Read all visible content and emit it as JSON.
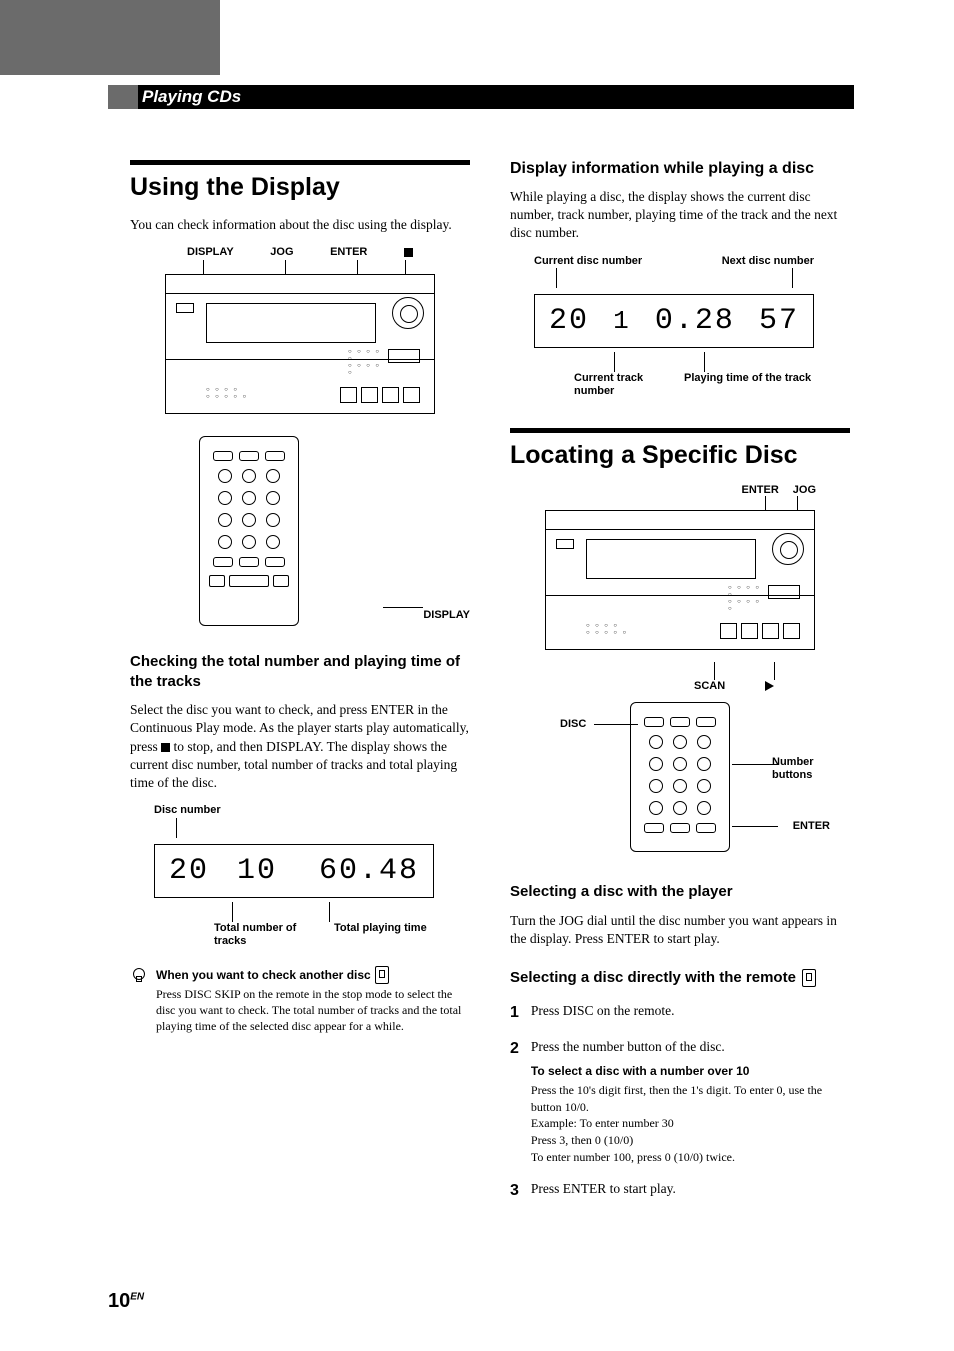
{
  "section_bar": "Playing CDs",
  "left": {
    "h1": "Using the Display",
    "intro": "You can check information about the disc using the display.",
    "device_labels": {
      "display": "DISPLAY",
      "jog": "JOG",
      "enter": "ENTER"
    },
    "remote_label": "DISPLAY",
    "h3_check": "Checking the total number and playing time of the tracks",
    "check_body": "Select the disc you want to check, and press ENTER in the Continuous Play mode. As the player starts play automatically, press ■ to stop, and then DISPLAY. The display shows the current disc number, total number of tracks and total playing time of the disc.",
    "lcd1_labels": {
      "disc_number": "Disc number",
      "total_tracks": "Total number of tracks",
      "total_time": "Total playing time"
    },
    "lcd1_values": {
      "disc": "20",
      "tracks": "10",
      "time": "60.48"
    },
    "tip_title": "When you want to check another disc",
    "tip_body": "Press DISC SKIP on the remote in the stop mode to select the disc you want to check. The total number of tracks and the total playing time of the selected disc appear for a while."
  },
  "right": {
    "h2_info": "Display information while playing a disc",
    "info_body": "While playing a disc, the display shows the current disc number, track number, playing time of the track and the next disc number.",
    "lcd2_labels": {
      "cur_disc": "Current disc number",
      "next_disc": "Next disc number",
      "cur_track": "Current track number",
      "play_time": "Playing time of the track"
    },
    "lcd2_values": {
      "cur_disc": "20",
      "track": "1",
      "time": "0.28",
      "next_disc": "57"
    },
    "h1_locate": "Locating a Specific Disc",
    "device2_labels": {
      "enter": "ENTER",
      "jog": "JOG",
      "scan": "SCAN"
    },
    "remote2_labels": {
      "disc": "DISC",
      "number": "Number buttons",
      "enter": "ENTER"
    },
    "h3_sel_player": "Selecting a disc with the player",
    "sel_player_body": "Turn the JOG dial until the disc number you want appears in the display. Press ENTER to start play.",
    "h3_sel_remote": "Selecting a disc directly with the remote",
    "steps": {
      "s1": "Press DISC on the remote.",
      "s2": "Press the number button of the disc.",
      "s2_note_title": "To select a disc with a number over 10",
      "s2_note_body1": "Press the 10's digit first, then the 1's digit. To enter 0, use the button 10/0.",
      "s2_note_body2": "Example:   To enter number 30",
      "s2_note_body3": "                  Press 3, then 0 (10/0)",
      "s2_note_body4": "To enter number 100, press 0 (10/0) twice.",
      "s3": "Press ENTER to start play."
    }
  },
  "page_number": "10",
  "page_number_suffix": "EN"
}
